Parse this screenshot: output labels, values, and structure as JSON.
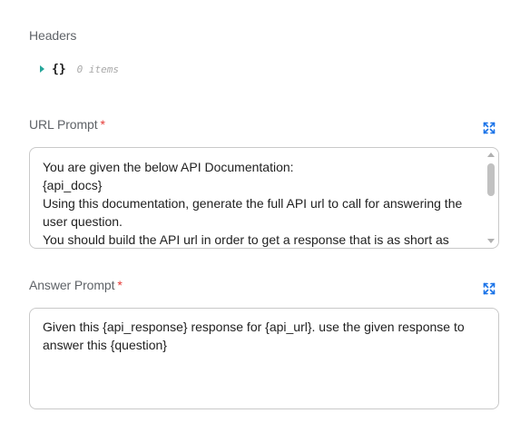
{
  "headers": {
    "label": "Headers",
    "value_braces": "{}",
    "item_count": "0 items"
  },
  "url_prompt": {
    "label": "URL Prompt",
    "required_mark": "*",
    "text": "You are given the below API Documentation:\n{api_docs}\nUsing this documentation, generate the full API url to call for answering the user question.\nYou should build the API url in order to get a response that is as short as"
  },
  "answer_prompt": {
    "label": "Answer Prompt",
    "required_mark": "*",
    "text": "Given this {api_response} response for {api_url}. use the given response to answer this {question}"
  },
  "icons": {
    "expand": "expand-icon",
    "caret": "caret-right-icon"
  },
  "colors": {
    "accent": "#1a73e8",
    "required": "#e53935",
    "caret": "#26a69a"
  }
}
